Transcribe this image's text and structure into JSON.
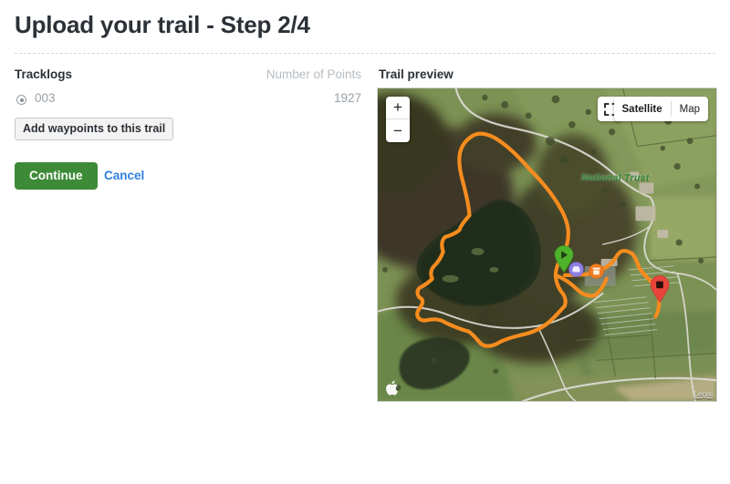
{
  "page": {
    "title": "Upload your trail - Step 2/4"
  },
  "tracklogs_section": {
    "heading": "Tracklogs",
    "points_column_header": "Number of Points",
    "rows": [
      {
        "name": "003",
        "points": "1927",
        "selected": true
      }
    ],
    "add_waypoints_label": "Add waypoints to this trail"
  },
  "actions": {
    "continue_label": "Continue",
    "cancel_label": "Cancel",
    "continue_color": "#3d8b37",
    "cancel_color": "#2f7fe0"
  },
  "preview": {
    "heading": "Trail preview",
    "map": {
      "zoom_in_label": "+",
      "zoom_out_label": "−",
      "fullscreen_icon": "fullscreen-icon",
      "map_types": [
        {
          "label": "Satellite",
          "selected": true
        },
        {
          "label": "Map",
          "selected": false
        }
      ],
      "attribution_logo": "apple-logo-icon",
      "legal_label": "Legal",
      "place_label": "National Trust",
      "place_label_color": "#2f8a2f",
      "track_color": "#f78c1e",
      "markers": [
        {
          "name": "start-marker",
          "icon": "play-icon",
          "color": "#4eb22b"
        },
        {
          "name": "poi-marker-parking",
          "icon": "info-icon",
          "color": "#8d7fe0"
        },
        {
          "name": "poi-marker-cafe",
          "icon": "cafe-icon",
          "color": "#f07c22"
        },
        {
          "name": "finish-marker",
          "icon": "stop-icon",
          "color": "#e8463c"
        }
      ]
    }
  }
}
